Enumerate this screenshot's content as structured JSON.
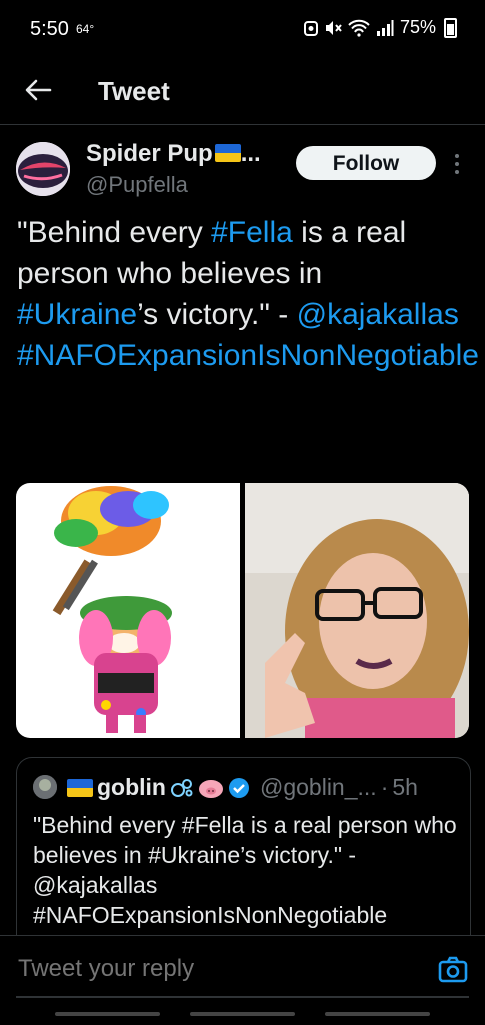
{
  "status_bar": {
    "time": "5:50",
    "temp": "64°",
    "battery": "75%"
  },
  "header": {
    "title": "Tweet"
  },
  "author": {
    "name": "Spider Pup",
    "name_suffix": "...",
    "handle": "@Pupfella",
    "follow_label": "Follow"
  },
  "tweet": {
    "parts": [
      {
        "t": "\"Behind every ",
        "link": false
      },
      {
        "t": "#Fella",
        "link": true
      },
      {
        "t": " is a real person who believes in ",
        "link": false
      },
      {
        "t": "#Ukraine",
        "link": true
      },
      {
        "t": "’s victory.\" - ",
        "link": false
      },
      {
        "t": "@kajakallas",
        "link": true
      },
      {
        "t": " ",
        "link": false
      },
      {
        "t": "#NAFOExpansionIsNonNegotiable",
        "link": true
      }
    ]
  },
  "quote": {
    "name": "goblin",
    "handle": "@goblin_...",
    "separator": "·",
    "time": "5h",
    "text": "\"Behind every #Fella is a real person who believes in #Ukraine’s victory.\" - @kajakallas #NAFOExpansionIsNonNegotiable"
  },
  "reply": {
    "placeholder": "Tweet your reply"
  },
  "colors": {
    "accent": "#1d9bf0",
    "background": "#000000",
    "muted": "#71767b"
  }
}
